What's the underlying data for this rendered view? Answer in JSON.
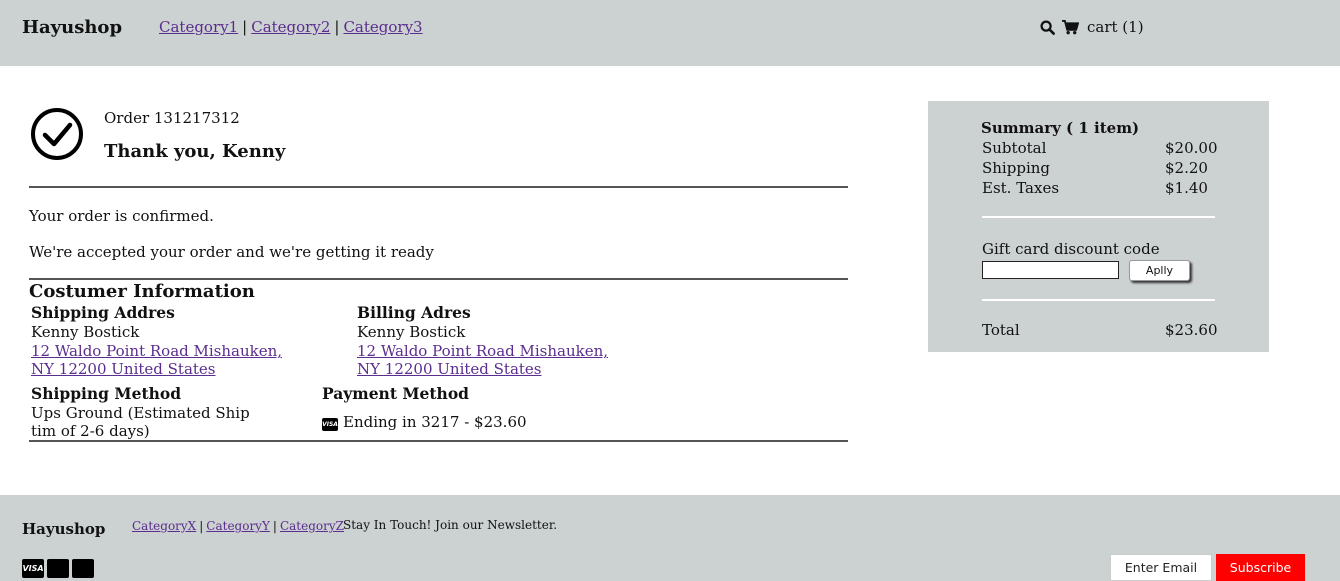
{
  "header": {
    "brand": "Hayushop",
    "nav": [
      "Category1",
      "Category2",
      "Category3"
    ],
    "separator": "|",
    "cart_label": "cart (1)",
    "icons": [
      "search-icon",
      "cart-icon"
    ]
  },
  "order": {
    "number_label": "Order 131217312",
    "thanks": "Thank you, Kenny",
    "confirmed": "Your order is confirmed.",
    "ready": "We're accepted your order and we're getting it ready"
  },
  "customer": {
    "title": "Costumer Information",
    "shipping_address": {
      "title": "Shipping Addres",
      "name": "Kenny Bostick",
      "line1": "12 Waldo Point Road Mishauken,",
      "line2": "NY 12200 United States"
    },
    "billing_address": {
      "title": "Billing Adres",
      "name": "Kenny Bostick",
      "line1": "12 Waldo Point Road Mishauken,",
      "line2": "NY 12200 United States"
    },
    "shipping_method": {
      "title": "Shipping Method",
      "line1": "Ups Ground (Estimated Ship",
      "line2": "tim of 2-6 days)"
    },
    "payment_method": {
      "title": "Payment Method",
      "card_brand": "VISA",
      "text": "Ending in 3217 - $23.60"
    }
  },
  "summary": {
    "title": "Summary ( 1 item)",
    "subtotal_label": "Subtotal",
    "subtotal_value": "$20.00",
    "shipping_label": "Shipping",
    "shipping_value": "$2.20",
    "taxes_label": "Est. Taxes",
    "taxes_value": "$1.40",
    "gift_label": "Gift card discount code",
    "gift_value": "",
    "apply_label": "Aplly",
    "total_label": "Total",
    "total_value": "$23.60"
  },
  "footer": {
    "brand": "Hayushop",
    "nav": [
      "CategoryX",
      "CategoryY",
      "CategoryZ"
    ],
    "separator": "|",
    "newsletter": "Stay In Touch! Join our Newsletter.",
    "payment_icons": [
      "VISA",
      "",
      ""
    ],
    "email_placeholder": "Enter Email",
    "subscribe_label": "Subscribe"
  },
  "colors": {
    "header_bg": "#ccd1d1",
    "link": "#5b2d8e",
    "subscribe_bg": "#ff0000"
  }
}
